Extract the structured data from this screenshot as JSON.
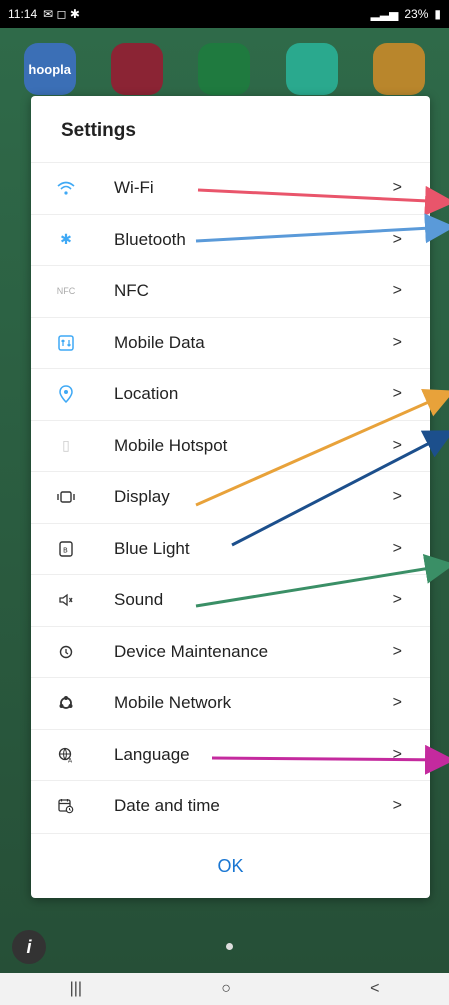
{
  "status": {
    "time": "11:14",
    "battery": "23%"
  },
  "apps": [
    {
      "label": "hoopla",
      "color": "#3b6fb6"
    },
    {
      "label": "",
      "color": "#8b2434"
    },
    {
      "label": "",
      "color": "#1f7a3f"
    },
    {
      "label": "",
      "color": "#2aa98e"
    },
    {
      "label": "",
      "color": "#b9862c"
    }
  ],
  "dialog": {
    "title": "Settings",
    "items": [
      {
        "label": "Wi-Fi",
        "icon": "wifi-icon"
      },
      {
        "label": "Bluetooth",
        "icon": "bluetooth-icon"
      },
      {
        "label": "NFC",
        "icon": "nfc-icon"
      },
      {
        "label": "Mobile Data",
        "icon": "mobile-data-icon"
      },
      {
        "label": "Location",
        "icon": "location-icon"
      },
      {
        "label": "Mobile Hotspot",
        "icon": "hotspot-icon"
      },
      {
        "label": "Display",
        "icon": "display-icon"
      },
      {
        "label": "Blue Light",
        "icon": "blue-light-icon"
      },
      {
        "label": "Sound",
        "icon": "sound-icon"
      },
      {
        "label": "Device Maintenance",
        "icon": "device-maintenance-icon"
      },
      {
        "label": "Mobile Network",
        "icon": "mobile-network-icon"
      },
      {
        "label": "Language",
        "icon": "language-icon"
      },
      {
        "label": "Date and time",
        "icon": "date-time-icon"
      }
    ],
    "chevron": ">",
    "ok_label": "OK"
  },
  "arrows": {
    "wifi": "#e9556b",
    "bluetooth": "#5a9ad9",
    "display": "#e8a23a",
    "blue_light": "#1c4f8c",
    "sound": "#3a8f66",
    "language": "#c42a9e"
  },
  "nav": {
    "recents": "|||",
    "home": "○",
    "back": "<"
  }
}
